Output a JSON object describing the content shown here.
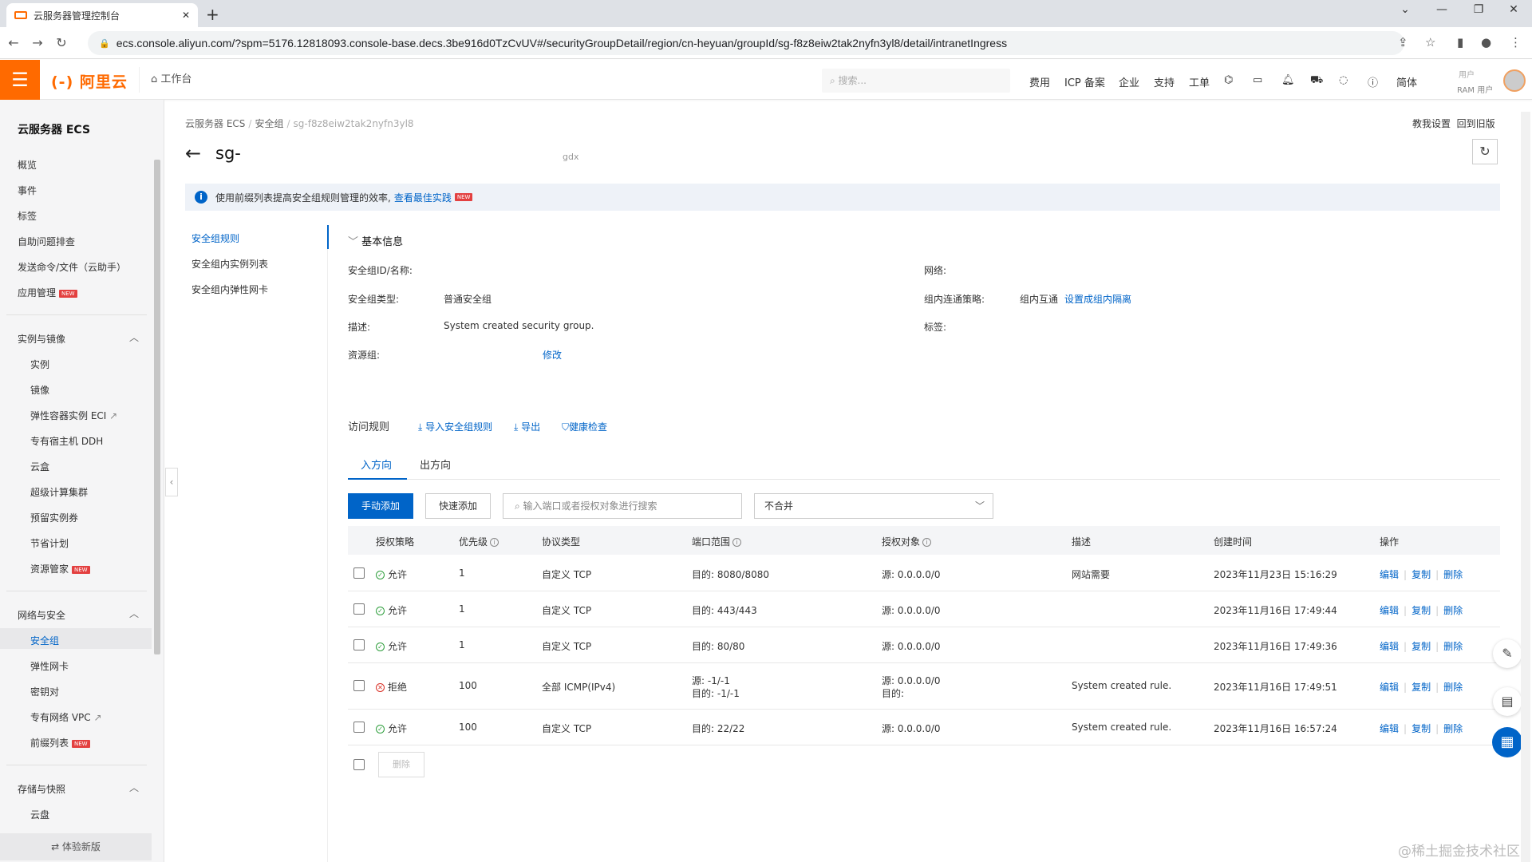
{
  "browser": {
    "tab_title": "云服务器管理控制台",
    "new_tab": "+",
    "url": "ecs.console.aliyun.com/?spm=5176.12818093.console-base.decs.3be916d0TzCvUV#/securityGroupDetail/region/cn-heyuan/groupId/sg-f8z8eiw2tak2nyfn3yl8/detail/intranetIngress"
  },
  "topnav": {
    "logo": "(-) 阿里云",
    "workbench": "工作台",
    "search_placeholder": "搜索...",
    "items": [
      "费用",
      "ICP 备案",
      "企业",
      "支持",
      "工单"
    ],
    "lang": "简体",
    "user_top": "用户",
    "user_sub": "RAM 用户"
  },
  "sidebar": {
    "title": "云服务器 ECS",
    "top_items": [
      "概览",
      "事件",
      "标签",
      "自助问题排查",
      "发送命令/文件（云助手）",
      "应用管理"
    ],
    "group1": {
      "title": "实例与镜像",
      "items": [
        "实例",
        "镜像",
        "弹性容器实例 ECI",
        "专有宿主机 DDH",
        "云盒",
        "超级计算集群",
        "预留实例券",
        "节省计划",
        "资源管家"
      ]
    },
    "group2": {
      "title": "网络与安全",
      "items": [
        "安全组",
        "弹性网卡",
        "密钥对",
        "专有网络 VPC",
        "前缀列表"
      ]
    },
    "group3": {
      "title": "存储与快照",
      "items": [
        "云盘"
      ]
    },
    "new_badge": "NEW",
    "footer": "⇄ 体验新版"
  },
  "breadcrumb": [
    "云服务器 ECS",
    "安全组",
    "sg-f8z8eiw2tak2nyfn3yl8"
  ],
  "top_links": [
    "教我设置",
    "回到旧版"
  ],
  "page": {
    "title": "sg-",
    "title_suffix": "gdx"
  },
  "infobar": {
    "text": "使用前缀列表提高安全组规则管理的效率,",
    "link": "查看最佳实践"
  },
  "secnav": [
    "安全组规则",
    "安全组内实例列表",
    "安全组内弹性网卡"
  ],
  "basic": {
    "header": "基本信息",
    "id_label": "安全组ID/名称:",
    "network_label": "网络:",
    "type_label": "安全组类型:",
    "type_value": "普通安全组",
    "policy_label": "组内连通策略:",
    "policy_value": "组内互通",
    "policy_link": "设置成组内隔离",
    "desc_label": "描述:",
    "desc_value": "System created security group.",
    "tag_label": "标签:",
    "rg_label": "资源组:",
    "rg_link": "修改"
  },
  "access": {
    "header": "访问规则",
    "import": "导入安全组规则",
    "export": "导出",
    "health": "健康检查",
    "tab_in": "入方向",
    "tab_out": "出方向",
    "btn_manual": "手动添加",
    "btn_quick": "快速添加",
    "filter_placeholder": "输入端口或者授权对象进行搜索",
    "merge": "不合并",
    "delete_btn": "删除"
  },
  "table": {
    "headers": [
      "授权策略",
      "优先级",
      "协议类型",
      "端口范围",
      "授权对象",
      "描述",
      "创建时间",
      "操作"
    ],
    "ops": [
      "编辑",
      "复制",
      "删除"
    ],
    "rows": [
      {
        "policy": "允许",
        "allow": true,
        "priority": "1",
        "proto": "自定义 TCP",
        "port1": "目的: 8080/8080",
        "port2": "",
        "obj1": "源: 0.0.0.0/0",
        "obj2": "",
        "desc": "网站需要",
        "time": "2023年11月23日 15:16:29"
      },
      {
        "policy": "允许",
        "allow": true,
        "priority": "1",
        "proto": "自定义 TCP",
        "port1": "目的: 443/443",
        "port2": "",
        "obj1": "源: 0.0.0.0/0",
        "obj2": "",
        "desc": "",
        "time": "2023年11月16日 17:49:44"
      },
      {
        "policy": "允许",
        "allow": true,
        "priority": "1",
        "proto": "自定义 TCP",
        "port1": "目的: 80/80",
        "port2": "",
        "obj1": "源: 0.0.0.0/0",
        "obj2": "",
        "desc": "",
        "time": "2023年11月16日 17:49:36"
      },
      {
        "policy": "拒绝",
        "allow": false,
        "priority": "100",
        "proto": "全部 ICMP(IPv4)",
        "port1": "源: -1/-1",
        "port2": "目的: -1/-1",
        "obj1": "源: 0.0.0.0/0",
        "obj2": "目的:",
        "desc": "System created rule.",
        "time": "2023年11月16日 17:49:51"
      },
      {
        "policy": "允许",
        "allow": true,
        "priority": "100",
        "proto": "自定义 TCP",
        "port1": "目的: 22/22",
        "port2": "",
        "obj1": "源: 0.0.0.0/0",
        "obj2": "",
        "desc": "System created rule.",
        "time": "2023年11月16日 16:57:24"
      }
    ]
  },
  "watermark": "@稀土掘金技术社区",
  "colors": {
    "brand": "#ff6a00",
    "primary": "#0064c8",
    "allow": "#2e9e3c",
    "deny": "#d93026"
  }
}
